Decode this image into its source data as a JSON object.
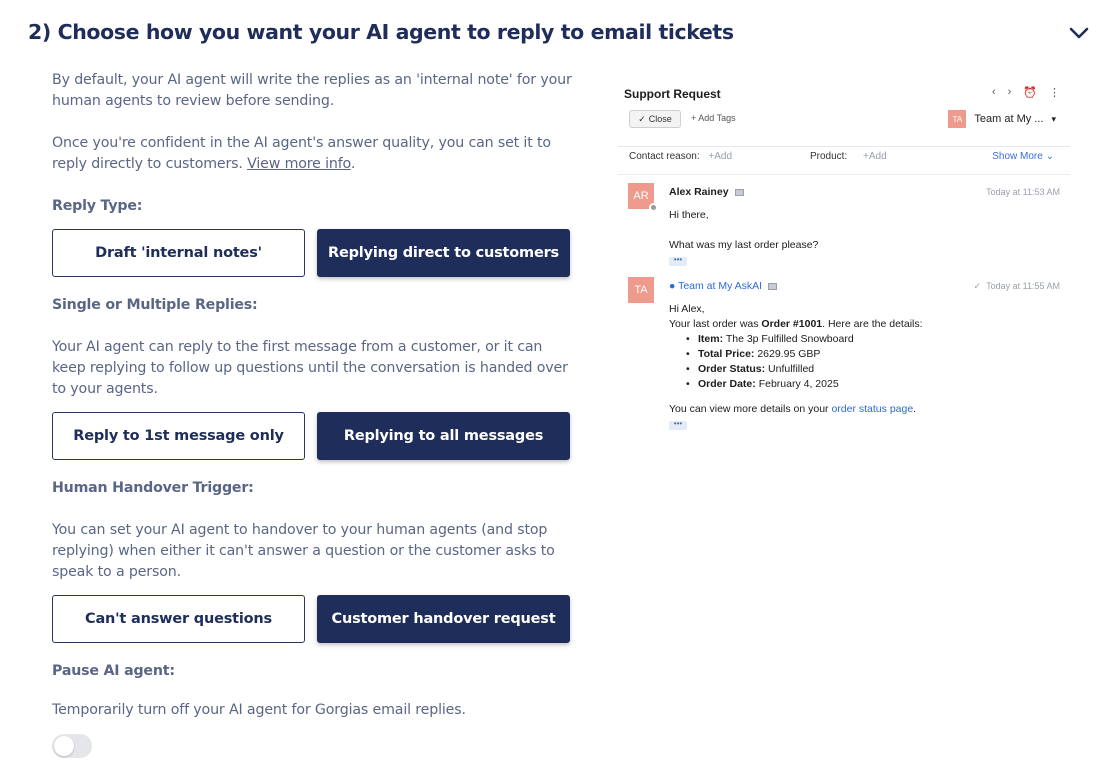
{
  "header": {
    "title": "2) Choose how you want your AI agent to reply to email tickets"
  },
  "intro": {
    "p1": "By default, your AI agent will write the replies as an 'internal note' for your human agents to review before sending.",
    "p2_prefix": "Once you're confident in the AI agent's answer quality, you can set it to reply directly to customers. ",
    "p2_link": "View more info",
    "p2_suffix": "."
  },
  "reply_type": {
    "label": "Reply Type:",
    "option_a": "Draft 'internal notes'",
    "option_b": "Replying direct to customers",
    "selected": "option_b"
  },
  "replies_mode": {
    "label": "Single or Multiple Replies:",
    "description": "Your AI agent can reply to the first message from a customer, or it can keep replying to follow up questions until the conversation is handed over to your agents.",
    "option_a": "Reply to 1st message only",
    "option_b": "Replying to all messages",
    "selected": "option_b"
  },
  "handover": {
    "label": "Human Handover Trigger:",
    "description": "You can set your AI agent to handover to your human agents (and stop replying) when either it can't answer a question or the customer asks to speak to a person.",
    "option_a": "Can't answer questions",
    "option_b": "Customer handover request",
    "selected": "option_b"
  },
  "pause": {
    "label": "Pause AI agent:",
    "description": "Temporarily turn off your AI agent for Gorgias email replies.",
    "enabled": false
  },
  "ticket": {
    "title": "Support Request",
    "close_label": "Close",
    "add_tags_label": "+ Add Tags",
    "team_initials": "TA",
    "team_name": "Team at My ...",
    "contact_reason_label": "Contact reason:",
    "contact_reason_value": "+Add",
    "product_label": "Product:",
    "product_value": "+Add",
    "show_more": "Show More",
    "messages": [
      {
        "initials": "AR",
        "name": "Alex Rainey",
        "time": "Today at 11:53 AM",
        "line1": "Hi there,",
        "line2": "What was my last order please?"
      },
      {
        "initials": "TA",
        "name": "Team at My AskAI",
        "time": "Today at 11:55 AM",
        "greeting": "Hi Alex,",
        "intro_prefix": "Your last order was ",
        "intro_bold": "Order #1001",
        "intro_suffix": ". Here are the details:",
        "details": [
          {
            "key": "Item:",
            "value": "The 3p Fulfilled Snowboard"
          },
          {
            "key": "Total Price:",
            "value": "2629.95 GBP"
          },
          {
            "key": "Order Status:",
            "value": "Unfulfilled"
          },
          {
            "key": "Order Date:",
            "value": "February 4, 2025"
          }
        ],
        "footer_prefix": "You can view more details on your ",
        "footer_link": "order status page",
        "footer_suffix": "."
      }
    ]
  },
  "colors": {
    "navy": "#1f2d5a",
    "muted_text": "#5a6685",
    "avatar": "#ee9a8d",
    "link_blue": "#2c6bd6"
  }
}
